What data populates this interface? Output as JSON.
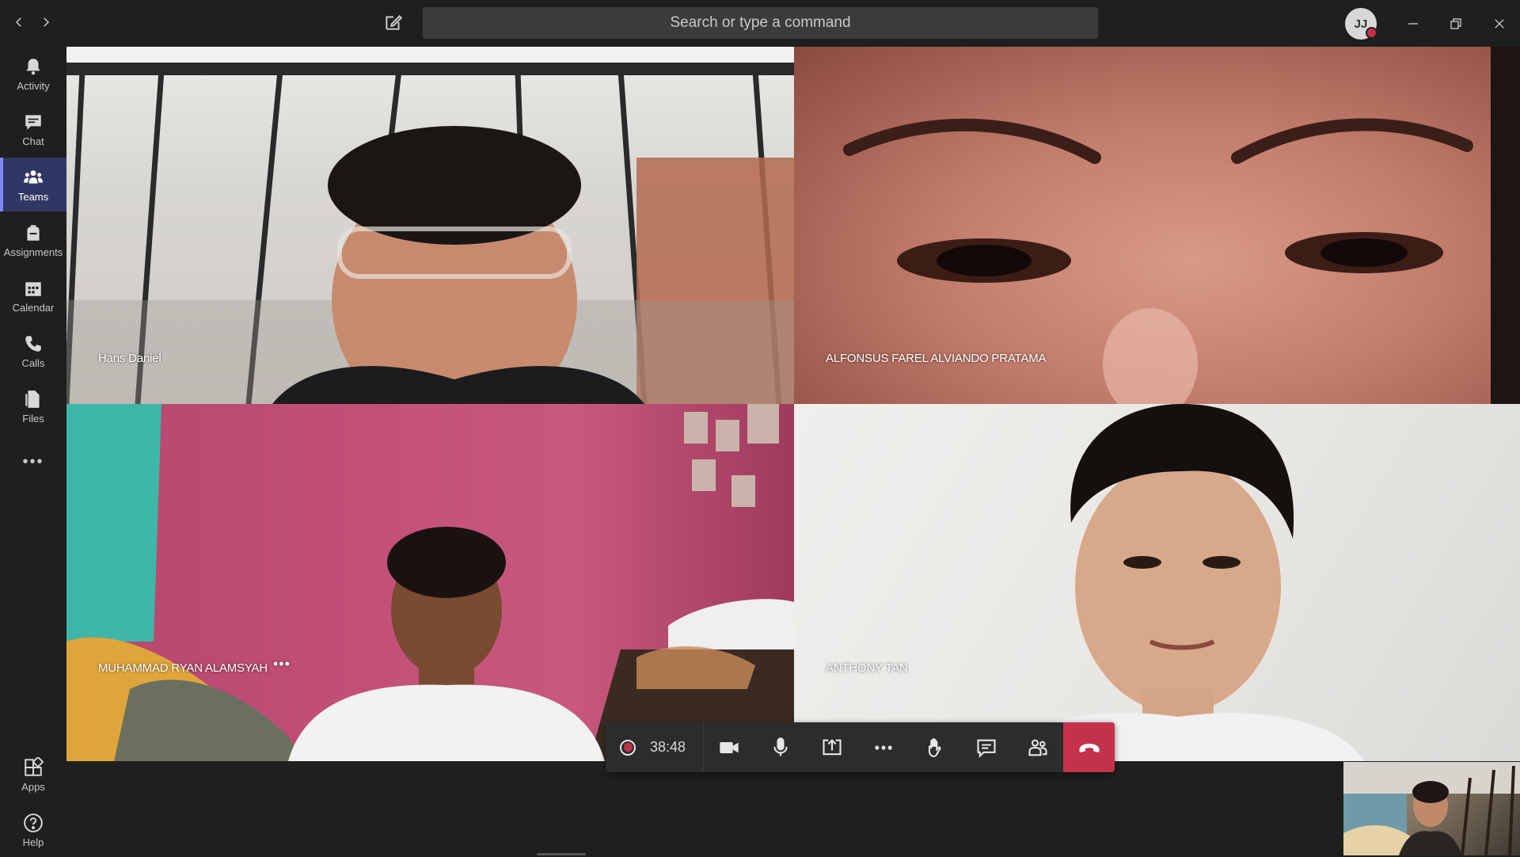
{
  "titlebar": {
    "search_placeholder": "Search or type a command",
    "avatar_initials": "JJ"
  },
  "rail": {
    "items": [
      {
        "label": "Activity",
        "icon": "bell-icon"
      },
      {
        "label": "Chat",
        "icon": "chat-icon"
      },
      {
        "label": "Teams",
        "icon": "teams-icon",
        "active": true
      },
      {
        "label": "Assignments",
        "icon": "backpack-icon"
      },
      {
        "label": "Calendar",
        "icon": "calendar-icon"
      },
      {
        "label": "Calls",
        "icon": "phone-icon"
      },
      {
        "label": "Files",
        "icon": "file-icon"
      }
    ],
    "more": "•••",
    "bottom": [
      {
        "label": "Apps",
        "icon": "apps-icon"
      },
      {
        "label": "Help",
        "icon": "help-icon"
      }
    ]
  },
  "participants": [
    {
      "name": "Hans Daniel"
    },
    {
      "name": "ALFONSUS FAREL ALVIANDO PRATAMA"
    },
    {
      "name": "MUHAMMAD RYAN ALAMSYAH",
      "more": "•••"
    },
    {
      "name": "ANTHONY TAN"
    }
  ],
  "call": {
    "duration": "38:48"
  },
  "colors": {
    "accent": "#7f85f5",
    "hangup": "#c4314b",
    "background": "#1f1f1f"
  }
}
